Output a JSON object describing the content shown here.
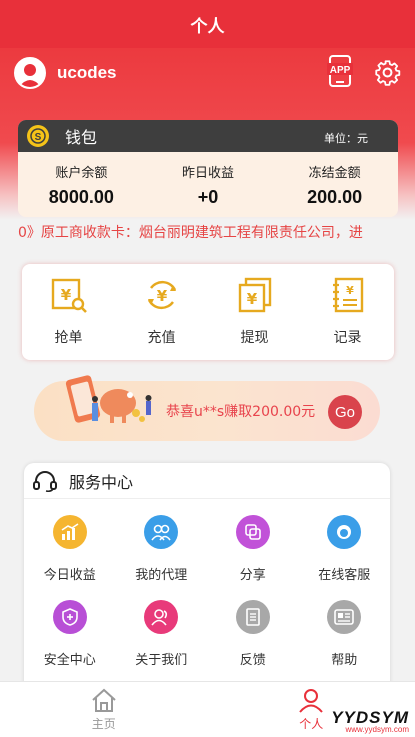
{
  "header": {
    "title": "个人"
  },
  "user": {
    "name": "ucodes",
    "app_badge": "APP"
  },
  "wallet": {
    "title": "钱包",
    "unit": "单位：元",
    "columns": [
      {
        "label": "账户余额",
        "value": "8000.00"
      },
      {
        "label": "昨日收益",
        "value": "+0"
      },
      {
        "label": "冻结金额",
        "value": "200.00"
      }
    ]
  },
  "marquee": {
    "text": "0》原工商收款卡：烟台丽明建筑工程有限责任公司，进"
  },
  "actions": [
    {
      "label": "抢单",
      "icon": "grab-order-icon"
    },
    {
      "label": "充值",
      "icon": "recharge-icon"
    },
    {
      "label": "提现",
      "icon": "withdraw-icon"
    },
    {
      "label": "记录",
      "icon": "records-icon"
    }
  ],
  "banner": {
    "text": "恭喜u**s赚取200.00元",
    "button": "Go"
  },
  "service": {
    "title": "服务中心",
    "items": [
      {
        "label": "今日收益",
        "icon": "chart-icon",
        "color": "#f5b530"
      },
      {
        "label": "我的代理",
        "icon": "agents-icon",
        "color": "#3a9ee8"
      },
      {
        "label": "分享",
        "icon": "share-icon",
        "color": "#c152d8"
      },
      {
        "label": "在线客服",
        "icon": "customer-service-icon",
        "color": "#3a9ee8"
      },
      {
        "label": "安全中心",
        "icon": "shield-icon",
        "color": "#b84fd6"
      },
      {
        "label": "关于我们",
        "icon": "about-icon",
        "color": "#e83a7a"
      },
      {
        "label": "反馈",
        "icon": "feedback-icon",
        "color": "#a8a8a8"
      },
      {
        "label": "帮助",
        "icon": "help-icon",
        "color": "#a8a8a8"
      }
    ]
  },
  "tabbar": {
    "items": [
      {
        "label": "主页",
        "icon": "home-icon"
      },
      {
        "label": "个人",
        "icon": "person-icon"
      }
    ]
  },
  "watermark": {
    "brand": "YYDSYM",
    "url": "www.yydsym.com"
  },
  "colors": {
    "brand_red": "#e8303a",
    "accent_gold": "#e6a91f"
  }
}
